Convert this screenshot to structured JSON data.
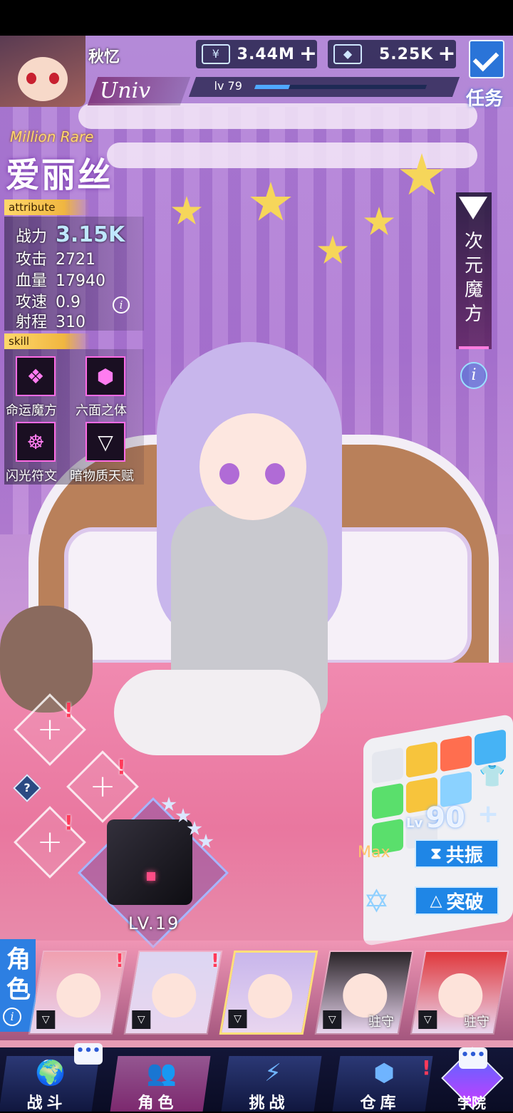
{
  "player": {
    "name": "秋忆",
    "guild": "Univ",
    "level_label": "lv 79",
    "level_progress": 0.2
  },
  "resources": {
    "gold": {
      "icon": "yen-icon",
      "symbol": "¥",
      "value": "3.44M"
    },
    "gems": {
      "icon": "crystal-icon",
      "value": "5.25K"
    }
  },
  "task": {
    "label": "任务"
  },
  "character": {
    "rarity": "Million Rare",
    "name": "爱丽丝",
    "attribute_tag": "attribute",
    "stats": [
      {
        "key": "战力",
        "value": "3.15K"
      },
      {
        "key": "攻击",
        "value": "2721"
      },
      {
        "key": "血量",
        "value": "17940"
      },
      {
        "key": "攻速",
        "value": "0.9"
      },
      {
        "key": "射程",
        "value": "310"
      }
    ],
    "skill_tag": "skill",
    "skills": [
      {
        "name": "命运魔方",
        "icon": "cube-icon"
      },
      {
        "name": "六面之体",
        "icon": "cubes-icon"
      },
      {
        "name": "闪光符文",
        "icon": "rune-icon"
      },
      {
        "name": "暗物质天赋",
        "icon": "triangle-icon"
      }
    ]
  },
  "side_tab": {
    "label": "次元魔方"
  },
  "core": {
    "level": "LV.19",
    "stars": 4
  },
  "upgrade": {
    "level_prefix": "Lv",
    "level": "90",
    "max_label": "Max",
    "resonance_label": "共振",
    "breakthrough_label": "突破"
  },
  "roster": {
    "label": "角色",
    "cards": [
      {
        "hair": "#f0a0b0",
        "guard": "",
        "alert": true
      },
      {
        "hair": "#dcd6f2",
        "guard": "",
        "alert": true
      },
      {
        "hair": "#c8b6ec",
        "guard": "",
        "alert": false,
        "selected": true
      },
      {
        "hair": "#2a2428",
        "guard": "驻守",
        "alert": false
      },
      {
        "hair": "#e0383c",
        "guard": "驻守",
        "alert": false
      }
    ]
  },
  "nav": {
    "battle": "战斗",
    "character": "角色",
    "challenge": "挑战",
    "warehouse": "仓库",
    "academy": "学院"
  },
  "colors": {
    "accent_blue": "#1f86e6",
    "alert_red": "#ff3a5a",
    "rarity_gold": "#ffd86b"
  }
}
